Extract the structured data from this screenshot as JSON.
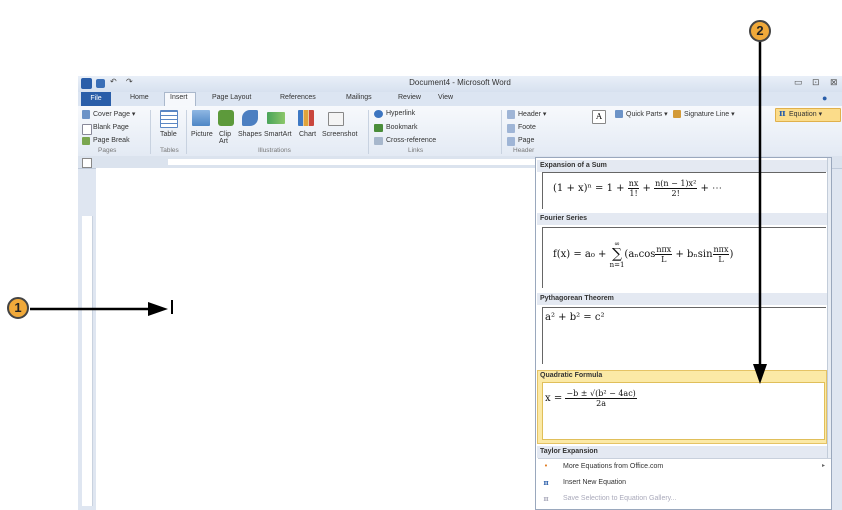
{
  "window": {
    "title": "Document4 - Microsoft Word",
    "min_glyph": "▭",
    "max_glyph": "⊡",
    "close_glyph": "⊠"
  },
  "tabs": [
    "File",
    "Home",
    "Insert",
    "Page Layout",
    "References",
    "Mailings",
    "Review",
    "View"
  ],
  "ribbon": {
    "pages": {
      "cover_page": "Cover Page ▾",
      "blank_page": "Blank Page",
      "page_break": "Page Break",
      "group": "Pages"
    },
    "tables": {
      "table": "Table",
      "group": "Tables"
    },
    "illustrations": {
      "picture": "Picture",
      "clip_art": "Clip Art",
      "shapes": "Shapes",
      "smartart": "SmartArt",
      "chart": "Chart",
      "screenshot": "Screenshot",
      "group": "Illustrations"
    },
    "links": {
      "hyperlink": "Hyperlink",
      "bookmark": "Bookmark",
      "cross_reference": "Cross-reference",
      "group": "Links"
    },
    "header_footer": {
      "header": "Header ▾",
      "footer": "Foote",
      "page": "Page",
      "group": "Header"
    },
    "text": {
      "quick_parts": "Quick Parts ▾",
      "signature_line": "Signature Line ▾"
    },
    "symbols": {
      "equation": "Equation ▾"
    }
  },
  "gallery": {
    "sections": [
      {
        "title": "Expansion of a Sum"
      },
      {
        "title": "Fourier Series"
      },
      {
        "title": "Pythagorean Theorem"
      },
      {
        "title": "Quadratic Formula"
      },
      {
        "title": "Taylor Expansion"
      }
    ],
    "equations": {
      "sum_lhs": "(1 + x)ⁿ = 1 + ",
      "sum_f1_num": "nx",
      "sum_f1_den": "1!",
      "sum_plus": " + ",
      "sum_f2_num": "n(n − 1)x²",
      "sum_f2_den": "2!",
      "sum_tail": " + ⋯",
      "fourier_lhs": "f(x) = a₀ + ",
      "fourier_sum": "∑",
      "fourier_sum_top": "∞",
      "fourier_sum_bot": "n=1",
      "fourier_body": "(aₙcos",
      "fourier_f1_num": "nπx",
      "fourier_f1_den": "L",
      "fourier_mid": " + bₙsin",
      "fourier_f2_num": "nπx",
      "fourier_f2_den": "L",
      "fourier_close": ")",
      "pythagorean": "a² + b² = c²",
      "quad_lhs": "x = ",
      "quad_num": "−b ± √(b² − 4ac)",
      "quad_den": "2a"
    },
    "menu": [
      {
        "icon": "•",
        "label": "More Equations from Office.com"
      },
      {
        "icon": "π",
        "label": "Insert New Equation"
      },
      {
        "icon": "π",
        "label": "Save Selection to Equation Gallery..."
      }
    ]
  },
  "callouts": {
    "one": "1",
    "two": "2"
  }
}
